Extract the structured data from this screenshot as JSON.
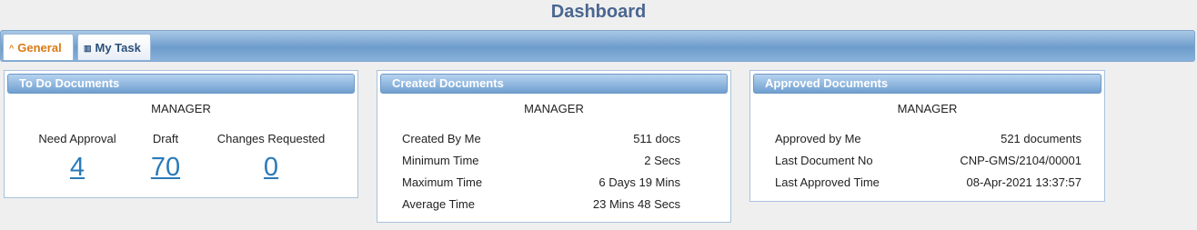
{
  "page_title": "Dashboard",
  "tabs": [
    {
      "label": "General",
      "icon": "chevron-up-icon",
      "active": true
    },
    {
      "label": "My Task",
      "icon": "grid-icon",
      "active": false
    }
  ],
  "todo": {
    "title": "To Do Documents",
    "role": "MANAGER",
    "columns": [
      {
        "label": "Need Approval",
        "count": "4"
      },
      {
        "label": "Draft",
        "count": "70"
      },
      {
        "label": "Changes Requested",
        "count": "0"
      }
    ]
  },
  "created": {
    "title": "Created Documents",
    "role": "MANAGER",
    "rows": [
      {
        "label": "Created By Me",
        "value": "511 docs"
      },
      {
        "label": "Minimum Time",
        "value": "2 Secs"
      },
      {
        "label": "Maximum Time",
        "value": "6 Days 19 Mins"
      },
      {
        "label": "Average Time",
        "value": "23 Mins 48 Secs"
      }
    ]
  },
  "approved": {
    "title": "Approved Documents",
    "role": "MANAGER",
    "rows": [
      {
        "label": "Approved by Me",
        "value": "521 documents"
      },
      {
        "label": "Last Document No",
        "value": "CNP-GMS/2104/00001"
      },
      {
        "label": "Last Approved Time",
        "value": "08-Apr-2021 13:37:57"
      }
    ]
  },
  "colors": {
    "title": "#4a6690",
    "link": "#2a7ab8",
    "active_tab": "#d97a14"
  }
}
